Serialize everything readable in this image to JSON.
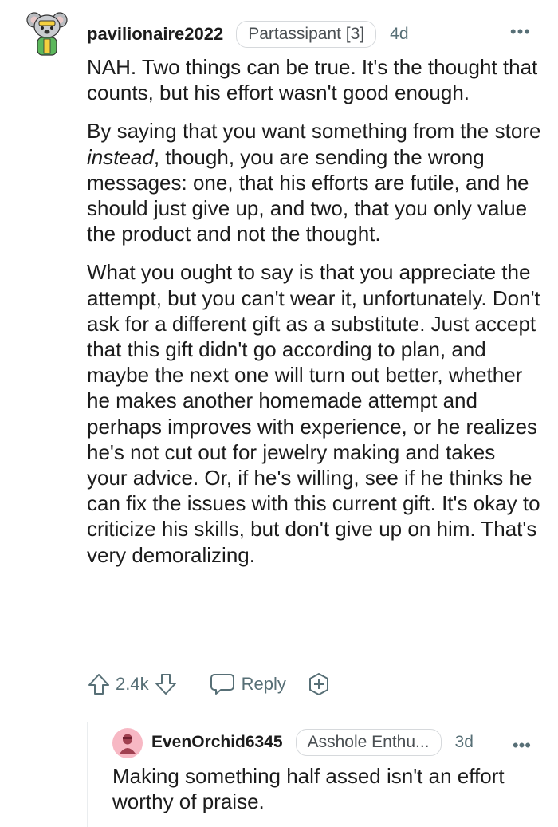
{
  "comment": {
    "username": "pavilionaire2022",
    "flair": "Partassipant [3]",
    "time": "4d",
    "more_icon": "more-horizontal-icon",
    "paragraph1": "NAH. Two things can be true. It's the thought that counts, but his effort wasn't good enough.",
    "paragraph2_before": "By saying that you want something from the store ",
    "paragraph2_emph": "instead",
    "paragraph2_after": ", though, you are sending the wrong messages: one, that his efforts are futile, and he should just give up, and two, that you only value the product and not the thought.",
    "paragraph3": "What you ought to say is that you appreciate the attempt, but you can't wear it, unfortunately. Don't ask for a different gift as a substitute. Just accept that this gift didn't go according to plan, and maybe the next one will turn out better, whether he makes another homemade attempt and perhaps improves with experience, or he realizes he's not cut out for jewelry making and takes your advice. Or, if he's willing, see if he thinks he can fix the issues with this current gift. It's okay to criticize his skills, but don't give up on him. That's very demoralizing.",
    "score": "2.4k",
    "reply_label": "Reply"
  },
  "reply": {
    "username": "EvenOrchid6345",
    "flair": "Asshole Enthu...",
    "time": "3d",
    "text": "Making something half assed isn't an effort worthy of praise."
  },
  "colors": {
    "meta_gray": "#576f76",
    "flair_border": "#d6d9dc",
    "avatar_pink": "#f7b8c4"
  }
}
